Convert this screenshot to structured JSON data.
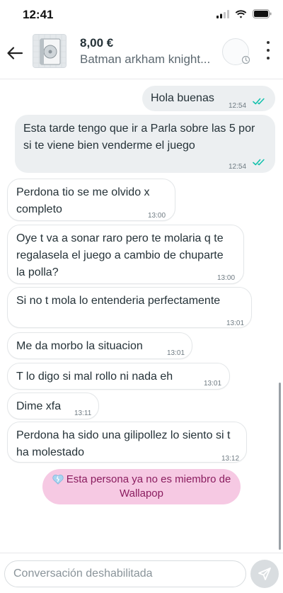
{
  "status_bar": {
    "time": "12:41"
  },
  "header": {
    "price": "8,00 €",
    "product_title": "Batman arkham knight..."
  },
  "messages": [
    {
      "text": "Hola buenas",
      "time": "12:54",
      "direction": "out"
    },
    {
      "text": "Esta tarde tengo que ir a Parla sobre las 5 por si te viene bien venderme el juego",
      "time": "12:54",
      "direction": "out"
    },
    {
      "text": "Perdona tio se me olvido x completo",
      "time": "13:00",
      "direction": "in"
    },
    {
      "text": "Oye t va a sonar raro pero te molaria q te regalasela el juego a cambio de chuparte la polla?",
      "time": "13:00",
      "direction": "in"
    },
    {
      "text": "Si no t mola lo entenderia perfectamente",
      "time": "13:01",
      "direction": "in"
    },
    {
      "text": "Me da morbo la situacion",
      "time": "13:01",
      "direction": "in"
    },
    {
      "text": "T lo digo si  mal rollo ni nada eh",
      "time": "13:01",
      "direction": "in"
    },
    {
      "text": "Dime xfa",
      "time": "13:11",
      "direction": "in"
    },
    {
      "text": "Perdona ha sido una gilipollez lo siento si t ha molestado",
      "time": "13:12",
      "direction": "in"
    }
  ],
  "notice": {
    "text": "Esta persona ya no es miembro de Wallapop"
  },
  "input": {
    "placeholder": "Conversación deshabilitada"
  },
  "colors": {
    "outgoing_bubble": "#eceff1",
    "incoming_bubble": "#ffffff",
    "read_checks": "#13c1ac",
    "notice_bg": "#f6c9e3",
    "notice_text": "#8a1d5f"
  }
}
